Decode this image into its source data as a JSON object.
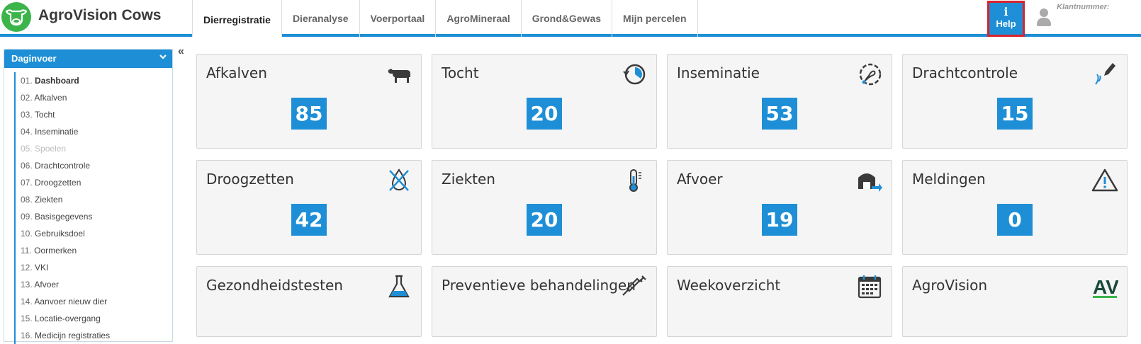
{
  "header": {
    "brand": "AgroVision Cows",
    "nav": [
      "Dierregistratie",
      "Dieranalyse",
      "Voerportaal",
      "AgroMineraal",
      "Grond&Gewas",
      "Mijn percelen"
    ],
    "active_nav": "Dierregistratie",
    "help_label": "Help",
    "help_icon": "info-icon",
    "klant_label": "Klantnummer:",
    "accent_color": "#1e8fd6"
  },
  "sidebar": {
    "title": "Daginvoer",
    "items": [
      {
        "num": "01.",
        "label": "Dashboard"
      },
      {
        "num": "02.",
        "label": "Afkalven"
      },
      {
        "num": "03.",
        "label": "Tocht"
      },
      {
        "num": "04.",
        "label": "Inseminatie"
      },
      {
        "num": "05.",
        "label": "Spoelen"
      },
      {
        "num": "06.",
        "label": "Drachtcontrole"
      },
      {
        "num": "07.",
        "label": "Droogzetten"
      },
      {
        "num": "08.",
        "label": "Ziekten"
      },
      {
        "num": "09.",
        "label": "Basisgegevens"
      },
      {
        "num": "10.",
        "label": "Gebruiksdoel"
      },
      {
        "num": "11.",
        "label": "Oormerken"
      },
      {
        "num": "12.",
        "label": "VKI"
      },
      {
        "num": "13.",
        "label": "Afvoer"
      },
      {
        "num": "14.",
        "label": "Aanvoer nieuw dier"
      },
      {
        "num": "15.",
        "label": "Locatie-overgang"
      },
      {
        "num": "16.",
        "label": "Medicijn registraties"
      }
    ],
    "collapse_glyph": "«"
  },
  "tiles": [
    {
      "title": "Afkalven",
      "count": "85",
      "icon": "cow-icon"
    },
    {
      "title": "Tocht",
      "count": "20",
      "icon": "clock-cycle-icon"
    },
    {
      "title": "Inseminatie",
      "count": "53",
      "icon": "sperm-icon"
    },
    {
      "title": "Drachtcontrole",
      "count": "15",
      "icon": "ultrasound-icon"
    },
    {
      "title": "Droogzetten",
      "count": "42",
      "icon": "no-milk-drop-icon"
    },
    {
      "title": "Ziekten",
      "count": "20",
      "icon": "thermometer-icon"
    },
    {
      "title": "Afvoer",
      "count": "19",
      "icon": "barn-exit-icon"
    },
    {
      "title": "Meldingen",
      "count": "0",
      "icon": "warning-icon"
    },
    {
      "title": "Gezondheidstesten",
      "icon": "flask-icon"
    },
    {
      "title": "Preventieve behandelingen",
      "icon": "syringe-icon"
    },
    {
      "title": "Weekoverzicht",
      "icon": "calendar-icon"
    },
    {
      "title": "AgroVision",
      "icon": "av-logo-icon",
      "logo_text": "AV"
    }
  ]
}
